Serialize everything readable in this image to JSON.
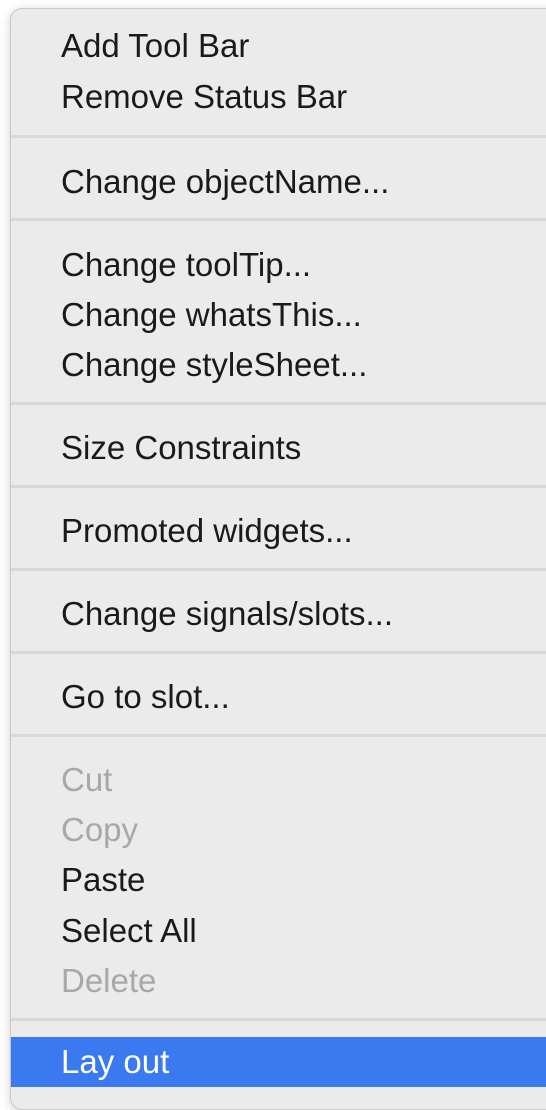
{
  "menu": {
    "items": [
      {
        "label": "Add Tool Bar",
        "enabled": true
      },
      {
        "label": "Remove Status Bar",
        "enabled": true
      },
      {
        "label": "Change objectName...",
        "enabled": true
      },
      {
        "label": "Change toolTip...",
        "enabled": true
      },
      {
        "label": "Change whatsThis...",
        "enabled": true
      },
      {
        "label": "Change styleSheet...",
        "enabled": true
      },
      {
        "label": "Size Constraints",
        "enabled": true
      },
      {
        "label": "Promoted widgets...",
        "enabled": true
      },
      {
        "label": "Change signals/slots...",
        "enabled": true
      },
      {
        "label": "Go to slot...",
        "enabled": true
      },
      {
        "label": "Cut",
        "enabled": false
      },
      {
        "label": "Copy",
        "enabled": false
      },
      {
        "label": "Paste",
        "enabled": true
      },
      {
        "label": "Select All",
        "enabled": true
      },
      {
        "label": "Delete",
        "enabled": false
      },
      {
        "label": "Lay out",
        "enabled": true,
        "highlighted": true
      }
    ]
  },
  "colors": {
    "menu_background": "#ebebeb",
    "highlight": "#3b79f1",
    "disabled_text": "#a8a8a8"
  }
}
